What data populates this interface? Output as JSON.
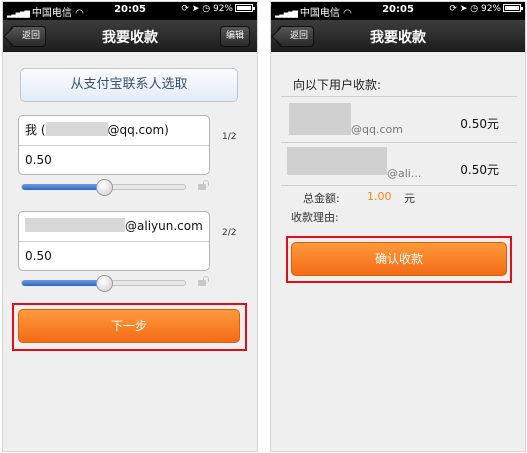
{
  "statusbar": {
    "carrier": "中国电信",
    "time": "20:05",
    "battery": "92%"
  },
  "left": {
    "nav": {
      "back_label": "返回",
      "title": "我要收款",
      "edit_label": "编辑"
    },
    "select_contact_label": "从支付宝联系人选取",
    "payers": [
      {
        "prefix": "我 (",
        "email_suffix": "@qq.com)",
        "amount": "0.50",
        "pager": "1/2",
        "slider_level": 0.5
      },
      {
        "prefix": "",
        "email_suffix": "@aliyun.com",
        "amount": "0.50",
        "pager": "2/2",
        "slider_level": 0.5
      }
    ],
    "next_label": "下一步"
  },
  "right": {
    "nav": {
      "back_label": "返回",
      "title": "我要收款"
    },
    "list_title": "向以下用户收款:",
    "items": [
      {
        "email_suffix": "@qq.com",
        "amount": "0.50元"
      },
      {
        "email_suffix": "@ali...",
        "amount": "0.50元"
      }
    ],
    "total_label": "总金额:",
    "total_value": "1.00",
    "total_unit": "元",
    "reason_label": "收款理由:",
    "confirm_label": "确认收款"
  },
  "colors": {
    "accent_orange": "#f36b16",
    "highlight_red": "#e0101b",
    "slider_blue": "#2f67c7"
  }
}
